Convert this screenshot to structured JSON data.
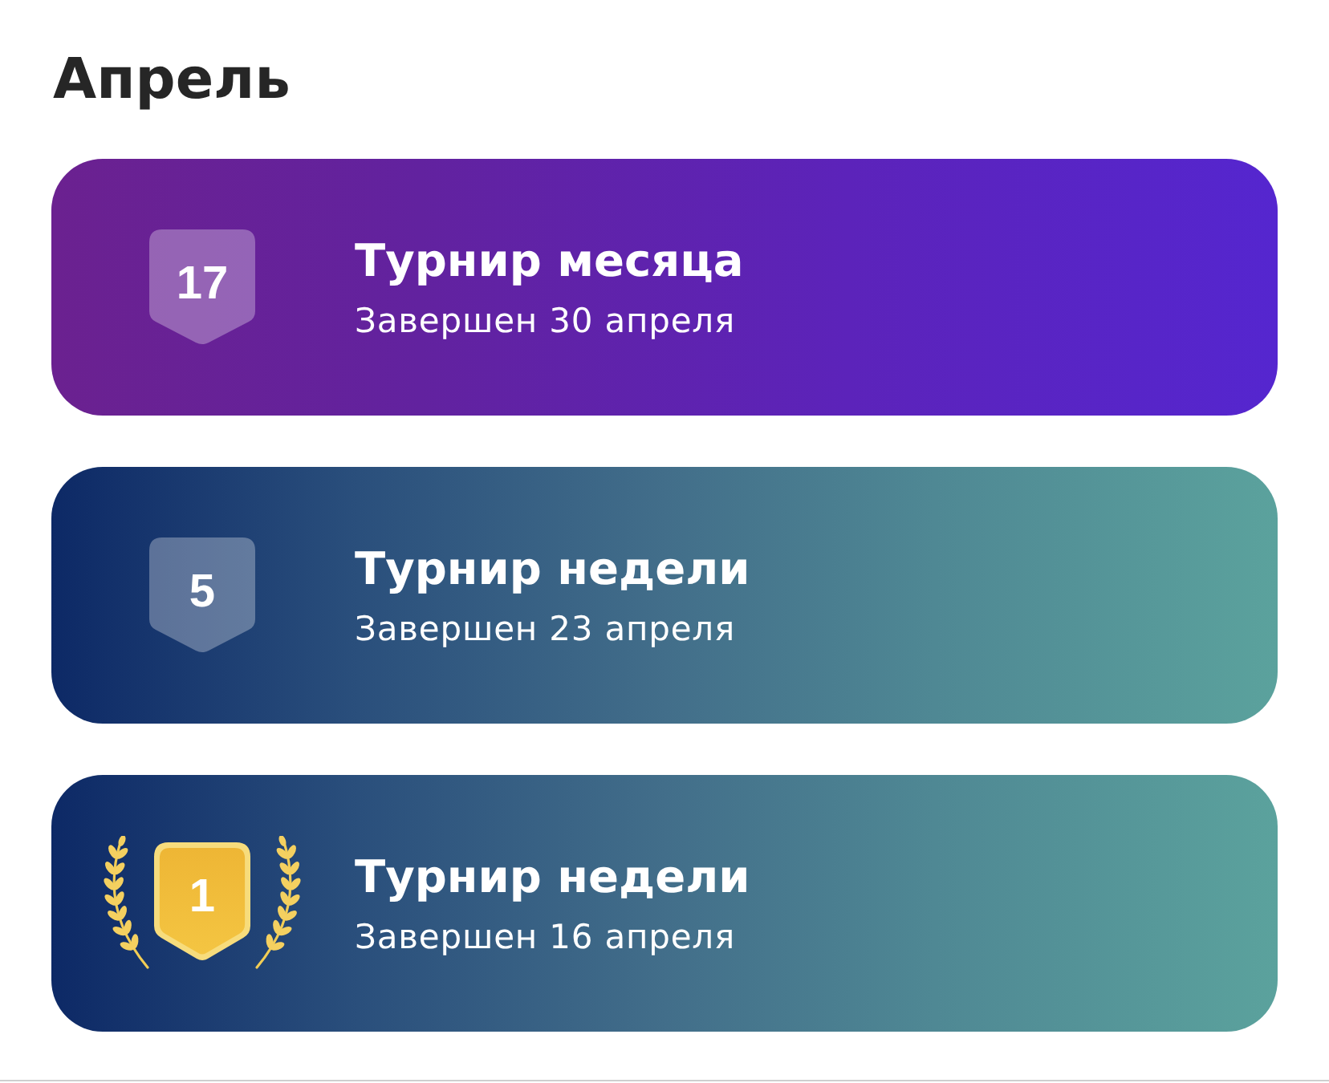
{
  "section": {
    "title": "Апрель"
  },
  "tournaments": [
    {
      "kind": "month",
      "badge": {
        "kind": "plain",
        "text": "17"
      },
      "title": "Турнир месяца",
      "subtitle": "Завершен 30 апреля"
    },
    {
      "kind": "week",
      "badge": {
        "kind": "plain",
        "text": "5"
      },
      "title": "Турнир недели",
      "subtitle": "Завершен 23 апреля"
    },
    {
      "kind": "week",
      "badge": {
        "kind": "gold",
        "text": "1"
      },
      "title": "Турнир недели",
      "subtitle": "Завершен 16 апреля"
    }
  ]
}
